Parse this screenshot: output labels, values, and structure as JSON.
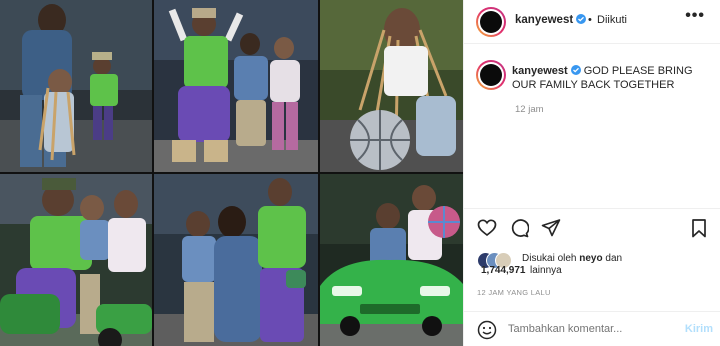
{
  "post": {
    "username": "kanyewest",
    "verified_icon": "verified-badge-icon",
    "separator": "•",
    "follow_status": "Diikuti",
    "more_icon": "more-options-icon",
    "caption_username": "kanyewest",
    "caption_text": "GOD PLEASE BRING OUR FAMILY BACK TOGETHER",
    "caption_time": "12 jam",
    "liked_by_prefix": "Disukai oleh",
    "liked_by_user": "neyo",
    "liked_by_and": "dan",
    "likes_count": "1,744,971",
    "likes_suffix": "lainnya",
    "post_time": "12 JAM YANG LALU",
    "comment_placeholder": "Tambahkan komentar...",
    "send_label": "Kirim"
  },
  "icons": {
    "like": "heart-icon",
    "comment": "comment-icon",
    "share": "send-icon",
    "save": "bookmark-icon",
    "emoji": "emoji-icon"
  },
  "colors": {
    "verified": "#3897f0",
    "send_disabled": "#b2dffc",
    "muted": "#8e8e8e",
    "text": "#262626"
  }
}
